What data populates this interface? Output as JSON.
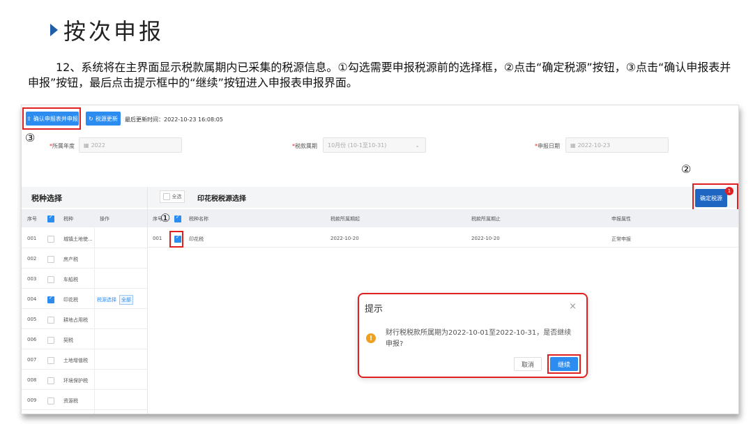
{
  "slide": {
    "title": "按次申报",
    "description": "12、系统将在主界面显示税款属期内已采集的税源信息。①勾选需要申报税源前的选择框，②点击“确定税源”按钮，③点击“确认申报表并申报”按钮，最后点击提示框中的“继续”按钮进入申报表申报界面。"
  },
  "toolbar": {
    "confirm_label": "确认申报表并申报",
    "refresh_label": "税源更新",
    "last_update_label": "最后更新时间：2022-10-23 16:08:05"
  },
  "markers": {
    "one": "①",
    "two": "②",
    "three": "③"
  },
  "form": {
    "year_label": "所属年度",
    "year_value": "2022",
    "period_label": "税款属期",
    "period_value": "10月份 (10-1至10-31)",
    "date_label": "申报日期",
    "date_value": "2022-10-23",
    "required_mark": "*"
  },
  "left_panel": {
    "title": "税种选择",
    "headers": {
      "no": "序号",
      "tax": "税种",
      "op": "操作"
    },
    "rows": [
      {
        "no": "001",
        "name": "城镇土地使...",
        "checked": false
      },
      {
        "no": "002",
        "name": "房产税",
        "checked": false
      },
      {
        "no": "003",
        "name": "车船税",
        "checked": false
      },
      {
        "no": "004",
        "name": "印花税",
        "checked": true
      },
      {
        "no": "005",
        "name": "耕地占用税",
        "checked": false
      },
      {
        "no": "006",
        "name": "契税",
        "checked": false
      },
      {
        "no": "007",
        "name": "土地增值税",
        "checked": false
      },
      {
        "no": "008",
        "name": "环境保护税",
        "checked": false
      },
      {
        "no": "009",
        "name": "资源税",
        "checked": false
      }
    ],
    "op_link": "税源选择",
    "op_tag": "全部"
  },
  "right_panel": {
    "select_all": "全选",
    "title": "印花税税源选择",
    "confirm_button": "确定税源",
    "badge": "1",
    "headers": {
      "no": "序号",
      "name": "税种名称",
      "start": "税款所属期起",
      "end": "税款所属期止",
      "nature": "申报属性"
    },
    "row": {
      "no": "001",
      "name": "印花税",
      "start": "2022-10-20",
      "end": "2022-10-20",
      "nature": "正常申报"
    }
  },
  "dialog": {
    "title": "提示",
    "close": "×",
    "message": "财行税税款所属期为2022-10-01至2022-10-31，是否继续申报?",
    "cancel": "取消",
    "continue": "继续"
  },
  "colors": {
    "primary": "#2d8cf0",
    "accent_red": "#e02020",
    "warning": "#f0a020",
    "title_triangle": "#1f5fa8"
  }
}
